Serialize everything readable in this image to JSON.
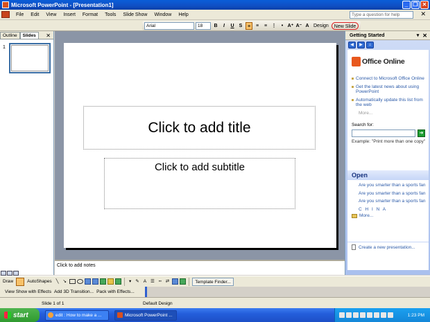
{
  "window": {
    "title": "Microsoft PowerPoint - [Presentation1]"
  },
  "menu": {
    "items": [
      "File",
      "Edit",
      "View",
      "Insert",
      "Format",
      "Tools",
      "Slide Show",
      "Window",
      "Help"
    ],
    "help_placeholder": "Type a question for help"
  },
  "format": {
    "font": "Arial",
    "size": "18",
    "bold": "B",
    "italic": "I",
    "underline": "U",
    "shadow": "S",
    "design": "Design",
    "new_slide": "New Slide"
  },
  "slides_panel": {
    "tab_outline": "Outline",
    "tab_slides": "Slides",
    "slide_number": "1"
  },
  "slide": {
    "title_placeholder": "Click to add title",
    "subtitle_placeholder": "Click to add subtitle"
  },
  "notes": {
    "placeholder": "Click to add notes"
  },
  "task_pane": {
    "title": "Getting Started",
    "logo_text": "Office Online",
    "links": [
      "Connect to Microsoft Office Online",
      "Get the latest news about using PowerPoint",
      "Automatically update this list from the web"
    ],
    "more": "More...",
    "search_label": "Search for:",
    "example": "Example: \"Print more than one copy\"",
    "open_header": "Open",
    "open_items": [
      "Are you smarter than a sports fan",
      "Are you smarter than a sports fan",
      "Are you smarter than a sports fan",
      "C H I N A"
    ],
    "open_more": "More...",
    "create_new": "Create a new presentation..."
  },
  "drawing": {
    "draw": "Draw",
    "autoshapes": "AutoShapes",
    "template_finder": "Template Finder..."
  },
  "animation": {
    "view_show": "View Show with Effects",
    "add_3d": "Add 3D Transition...",
    "pack": "Pack with Effects..."
  },
  "status": {
    "slide": "Slide 1 of 1",
    "design": "Default Design"
  },
  "taskbar": {
    "start": "start",
    "items": [
      "edit : How to make a ...",
      "Microsoft PowerPoint ..."
    ],
    "time": "1:23 PM"
  },
  "colors": {
    "title_bar": "#0a5ed8",
    "slide_area": "#8b95a6",
    "task_pane": "#c6d6f7",
    "link": "#2b5aa8"
  }
}
